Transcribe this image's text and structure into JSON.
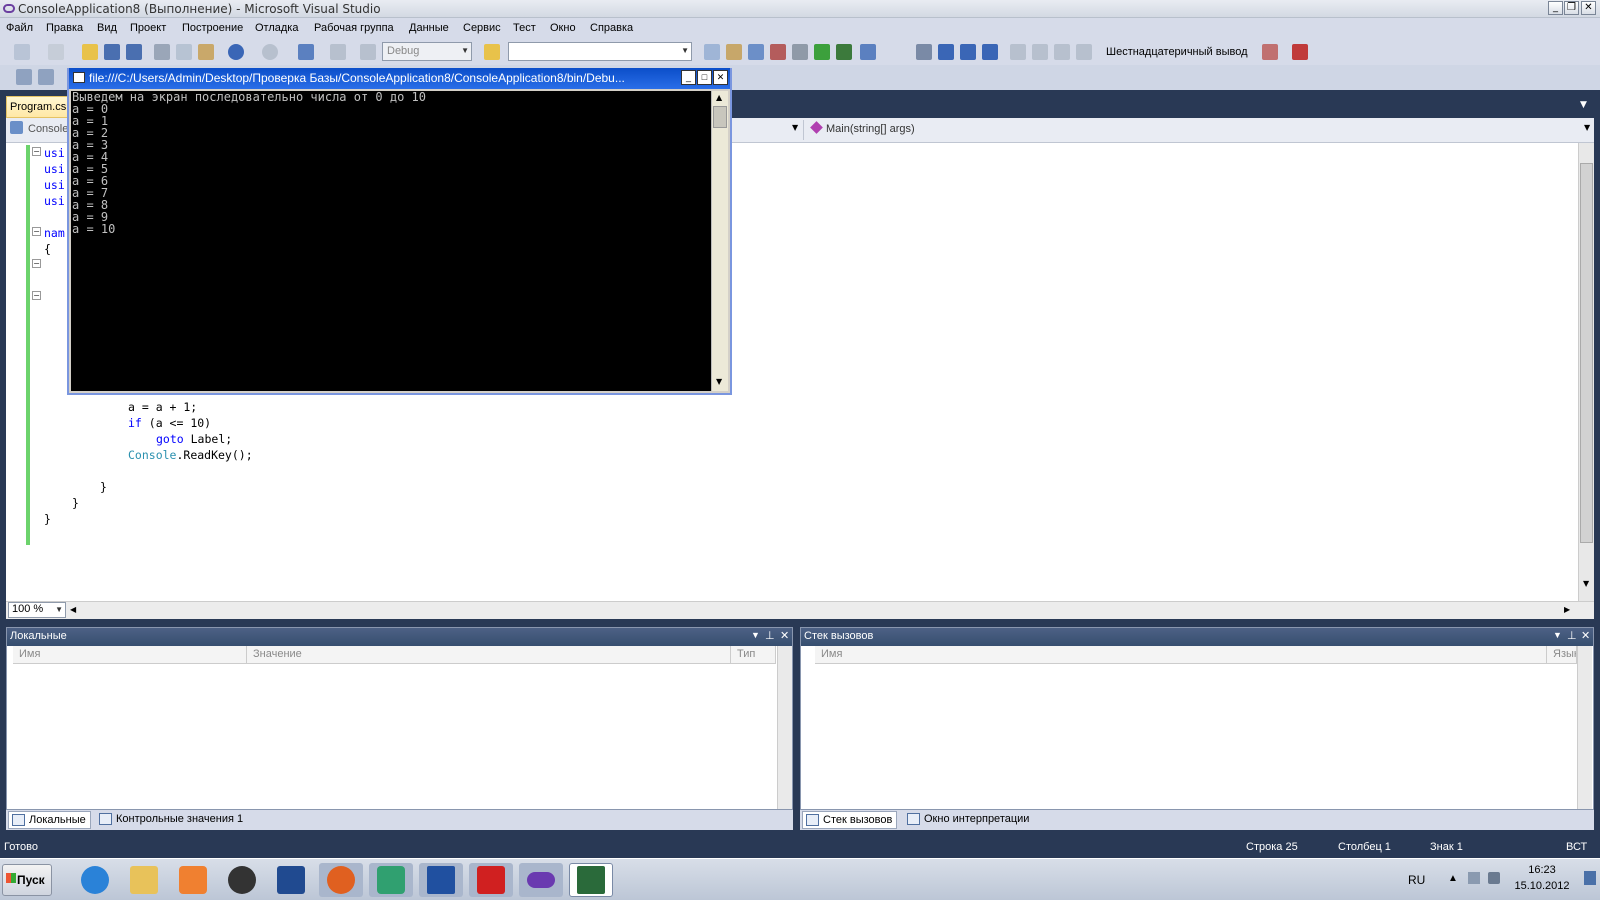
{
  "window": {
    "title": "ConsoleApplication8 (Выполнение) - Microsoft Visual Studio"
  },
  "menu": [
    "Файл",
    "Правка",
    "Вид",
    "Проект",
    "Построение",
    "Отладка",
    "Рабочая группа",
    "Данные",
    "Сервис",
    "Тест",
    "Окно",
    "Справка"
  ],
  "toolbar": {
    "config": "Debug",
    "hex_label": "Шестнадцатеричный вывод"
  },
  "editor": {
    "tab": "Program.cs",
    "nav_left": "Console",
    "nav_right": "Main(string[] args)",
    "zoom": "100 %",
    "code_top": [
      "usi",
      "usi",
      "usi",
      "usi",
      "",
      "nam",
      "{"
    ],
    "code_bottom": [
      "a = a + 1;",
      "if (a <= 10)",
      "goto Label;",
      "Console.ReadKey();",
      "}",
      "}",
      "}"
    ]
  },
  "console": {
    "title": "file:///C:/Users/Admin/Desktop/Проверка Базы/ConsoleApplication8/ConsoleApplication8/bin/Debu...",
    "output": "Выведем на экран последовательно числа от 0 до 10\na = 0\na = 1\na = 2\na = 3\na = 4\na = 5\na = 6\na = 7\na = 8\na = 9\na = 10"
  },
  "locals": {
    "title": "Локальные",
    "col_name": "Имя",
    "col_value": "Значение",
    "col_type": "Тип"
  },
  "callstack": {
    "title": "Стек вызовов",
    "col_name": "Имя",
    "col_lang": "Язык"
  },
  "left_tabs": [
    "Локальные",
    "Контрольные значения 1"
  ],
  "right_tabs": [
    "Стек вызовов",
    "Окно интерпретации"
  ],
  "status": {
    "ready": "Готово",
    "line": "Строка 25",
    "col": "Столбец 1",
    "char": "Знак 1",
    "mode": "ВСТ"
  },
  "taskbar": {
    "start": "Пуск",
    "lang": "RU",
    "time": "16:23",
    "date": "15.10.2012"
  }
}
